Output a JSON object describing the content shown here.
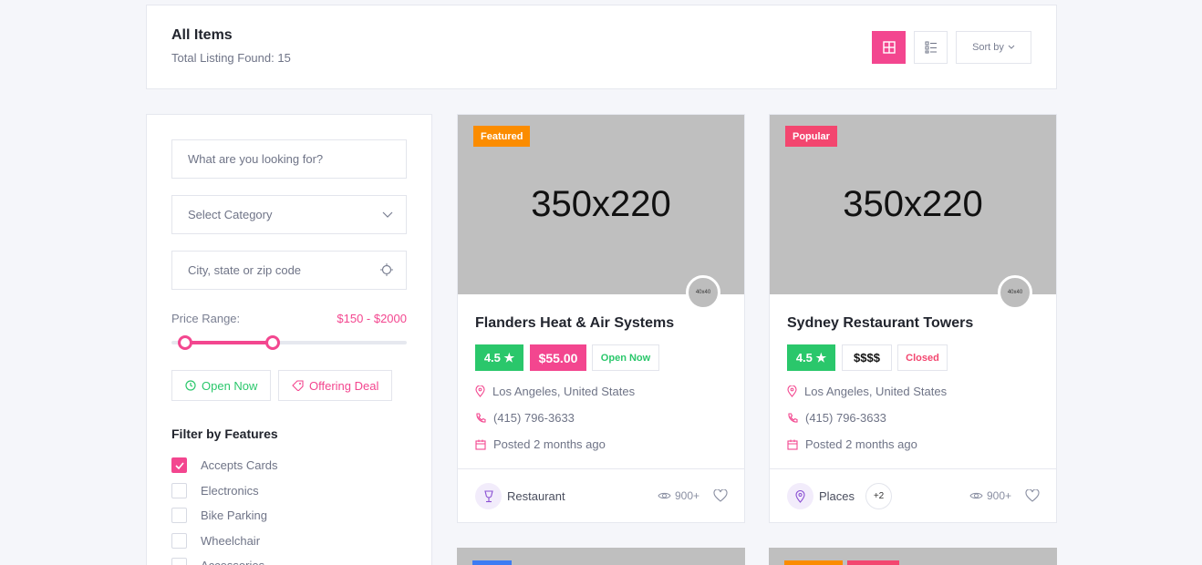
{
  "header": {
    "title": "All Items",
    "subtitle": "Total Listing Found: 15",
    "sort_label": "Sort by",
    "accent": "#f3468f"
  },
  "sidebar": {
    "search_placeholder": "What are you looking for?",
    "category_placeholder": "Select Category",
    "location_placeholder": "City, state or zip code",
    "price_label": "Price Range:",
    "price_value": "$150 - $2000",
    "price_min_fraction": 0.06,
    "price_max_fraction": 0.43,
    "open_now": "Open Now",
    "offering_deal": "Offering Deal",
    "filter_title": "Filter by Features",
    "features": [
      {
        "label": "Accepts Cards",
        "checked": true
      },
      {
        "label": "Electronics",
        "checked": false
      },
      {
        "label": "Bike Parking",
        "checked": false
      },
      {
        "label": "Wheelchair",
        "checked": false
      },
      {
        "label": "Accessories",
        "checked": false
      }
    ]
  },
  "cards": [
    {
      "badge": "Featured",
      "badge_color": "#fb8c00",
      "image_text": "350x220",
      "avatar_text": "40x40",
      "name": "Flanders Heat & Air Systems",
      "rating": "4.5 ★",
      "price": "$55.00",
      "status": "Open Now",
      "location": "Los Angeles, United States",
      "phone": "(415) 796-3633",
      "posted": "Posted 2 months ago",
      "category": "Restaurant",
      "category_icon": "wine-glass-icon",
      "views": "900+"
    },
    {
      "badge": "Popular",
      "badge_color": "#f3466f",
      "image_text": "350x220",
      "avatar_text": "40x40",
      "name": "Sydney Restaurant Towers",
      "rating": "4.5 ★",
      "price_level": "$$$$",
      "status": "Closed",
      "location": "Los Angeles, United States",
      "phone": "(415) 796-3633",
      "posted": "Posted 2 months ago",
      "category": "Places",
      "category_icon": "map-pin-icon",
      "more": "+2",
      "views": "900+"
    }
  ]
}
